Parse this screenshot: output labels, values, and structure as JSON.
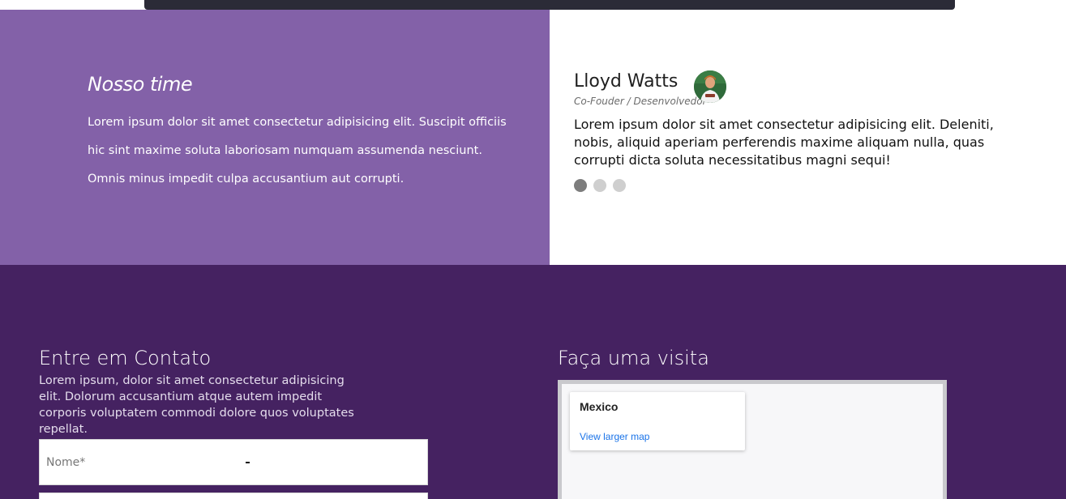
{
  "team": {
    "title": "Nosso time",
    "description": "Lorem ipsum dolor sit amet consectetur adipisicing elit. Suscipit officiis hic sint maxime soluta laboriosam numquam assumenda nesciunt. Omnis minus impedit culpa accusantium aut corrupti."
  },
  "testimonial": {
    "name": "Lloyd Watts",
    "role": "Co-Fouder / Desenvolvedor",
    "quote": "Lorem ipsum dolor sit amet consectetur adipisicing elit. Deleniti, nobis, aliquid aperiam perferendis maxime aliquam nulla, quas corrupti dicta soluta necessitatibus magni sequi!",
    "active_slide": 1,
    "slide_count": 3
  },
  "contact": {
    "title": "Entre em Contato",
    "description": "Lorem ipsum, dolor sit amet consectetur adipisicing elit. Dolorum accusantium atque autem impedit corporis voluptatem commodi dolore quos voluptates repellat.",
    "name_placeholder": "Nome*",
    "name_value": ""
  },
  "visit": {
    "title": "Faça uma visita",
    "map_place": "Mexico",
    "map_link": "View larger map"
  },
  "colors": {
    "team_bg": "#8361a8",
    "contact_bg": "#452261",
    "link": "#1a73e8"
  }
}
